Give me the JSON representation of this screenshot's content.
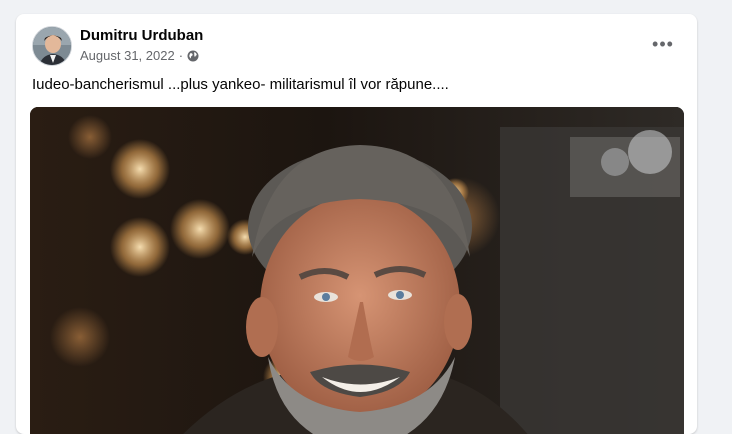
{
  "post": {
    "author": "Dumitru Urduban",
    "date": "August 31, 2022",
    "separator": "·",
    "privacy_icon": "globe-icon",
    "text": "Iudeo-bancherismul ...plus yankeo- militarismul îl vor răpune....",
    "more_icon": "more-options-icon",
    "more_glyph": "•••"
  },
  "colors": {
    "page_bg": "#f0f2f5",
    "card_bg": "#ffffff",
    "primary_text": "#050505",
    "secondary_text": "#65676b"
  }
}
